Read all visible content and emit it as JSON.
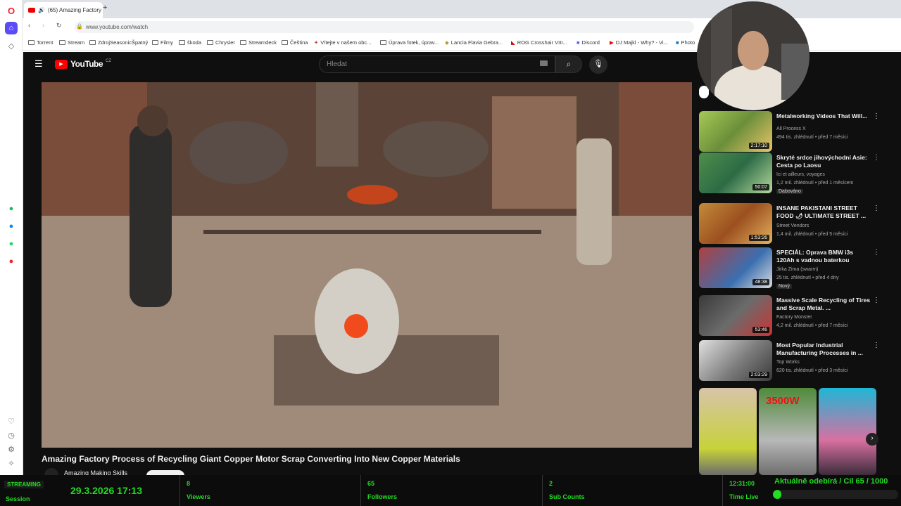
{
  "browser": {
    "tab_title": "(65) Amazing Factory",
    "url": "www.youtube.com/watch",
    "bookmarks": [
      "Torrent",
      "Stream",
      "ZdrojSeasonicŠpatný",
      "Filmy",
      "škoda",
      "Chrysler",
      "Streamdeck",
      "Čeština",
      "Vítejte v našem obc...",
      "Úprava fotek, úprav...",
      "Lancia Flavia Gebra...",
      "ROG Crosshair VIII...",
      "Discord",
      "DJ Majkl - Why? - Vi...",
      "Photo"
    ]
  },
  "youtube": {
    "logo": "YouTube",
    "region": "CZ",
    "search_placeholder": "Hledat",
    "video_title": "Amazing Factory Process of Recycling Giant Copper Motor Scrap Converting Into New Copper Materials",
    "channel_name": "Amazing Making Skills"
  },
  "recommendations": [
    {
      "title": "Metalworking Videos That Will...",
      "channel": "All Process X",
      "meta": "494 tis. zhlédnutí • před 7 měsíci",
      "duration": "2:17:10",
      "extra": ""
    },
    {
      "title": "Skryté srdce jihovýchodní Asie: Cesta po Laosu",
      "channel": "Ici et ailleurs, voyages",
      "meta": "1,2 mil. zhlédnutí • před 1 měsícem",
      "duration": "50:07",
      "extra": "Dabováno"
    },
    {
      "title": "INSANE PAKISTANI STREET FOOD 🌶 ULTIMATE STREET ...",
      "channel": "Street Vendors",
      "meta": "1,4 mil. zhlédnutí • před 5 měsíci",
      "duration": "1:53:26",
      "extra": ""
    },
    {
      "title": "SPECIÁL: Oprava BMW i3s 120Ah s vadnou baterkou",
      "channel": "Jirka Zima (swarm)",
      "meta": "25 tis. zhlédnutí • před 4 dny",
      "duration": "48:38",
      "extra": "Nový"
    },
    {
      "title": "Massive Scale Recycling of Tires and Scrap Metal. ...",
      "channel": "Factory Monster",
      "meta": "4,2 mil. zhlédnutí • před 7 měsíci",
      "duration": "53:46",
      "extra": ""
    },
    {
      "title": "Most Popular Industrial Manufacturing Processes in ...",
      "channel": "Top Works",
      "meta": "620 tis. zhlédnutí • před 3 měsíci",
      "duration": "2:03:29",
      "extra": ""
    }
  ],
  "shorts_badge": "3500W",
  "stream": {
    "status": "STREAMING",
    "session_label": "Session",
    "datetime": "29.3.2026 17:13",
    "viewers_val": "8",
    "viewers_label": "Viewers",
    "followers_val": "65",
    "followers_label": "Followers",
    "subs_val": "2",
    "subs_label": "Sub Counts",
    "time_val": "12:31:00",
    "time_label": "Time Live",
    "goal_text": "Aktuálně odebírá / Cíl  65 / 1000",
    "goal_progress": 0.065
  },
  "colors": {
    "accent_green": "#22dd22",
    "youtube_red": "#ff0000",
    "opera_red": "#ff1b2d"
  }
}
